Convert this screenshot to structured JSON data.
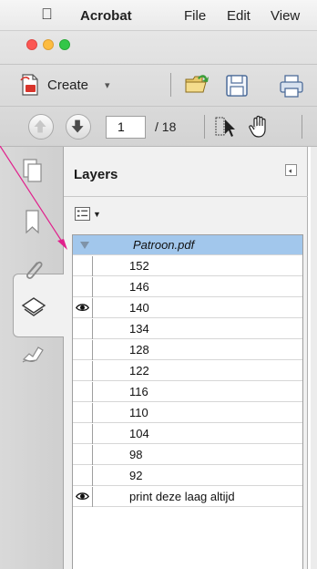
{
  "menubar": {
    "app": "Acrobat",
    "items": [
      "File",
      "Edit",
      "View"
    ]
  },
  "toolbar": {
    "create_label": "Create",
    "page_current": "1",
    "page_total": "/ 18"
  },
  "panel": {
    "title": "Layers"
  },
  "layers": {
    "document": "Patroon.pdf",
    "items": [
      {
        "label": "152",
        "visible": false
      },
      {
        "label": "146",
        "visible": false
      },
      {
        "label": "140",
        "visible": true
      },
      {
        "label": "134",
        "visible": false
      },
      {
        "label": "128",
        "visible": false
      },
      {
        "label": "122",
        "visible": false
      },
      {
        "label": "116",
        "visible": false
      },
      {
        "label": "110",
        "visible": false
      },
      {
        "label": "104",
        "visible": false
      },
      {
        "label": "98",
        "visible": false
      },
      {
        "label": "92",
        "visible": false
      },
      {
        "label": "print deze laag altijd",
        "visible": true
      }
    ]
  },
  "colors": {
    "annotation_arrow": "#e0208c",
    "selected_row": "#a2c7ec"
  }
}
